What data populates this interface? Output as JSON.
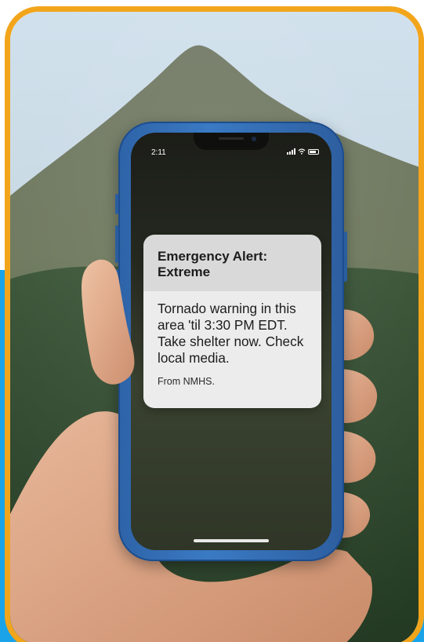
{
  "colors": {
    "frame": "#f2a51b",
    "accent_blue": "#1aa3e8",
    "phone_case": "#3a7ac4"
  },
  "phone": {
    "status_bar": {
      "time": "2:11"
    },
    "alert": {
      "title": "Emergency Alert: Extreme",
      "message": "Tornado warning in this area 'til 3:30 PM EDT. Take shelter now. Check local media.",
      "source": "From NMHS."
    }
  },
  "icons": [
    "signal-icon",
    "wifi-icon",
    "battery-icon"
  ]
}
